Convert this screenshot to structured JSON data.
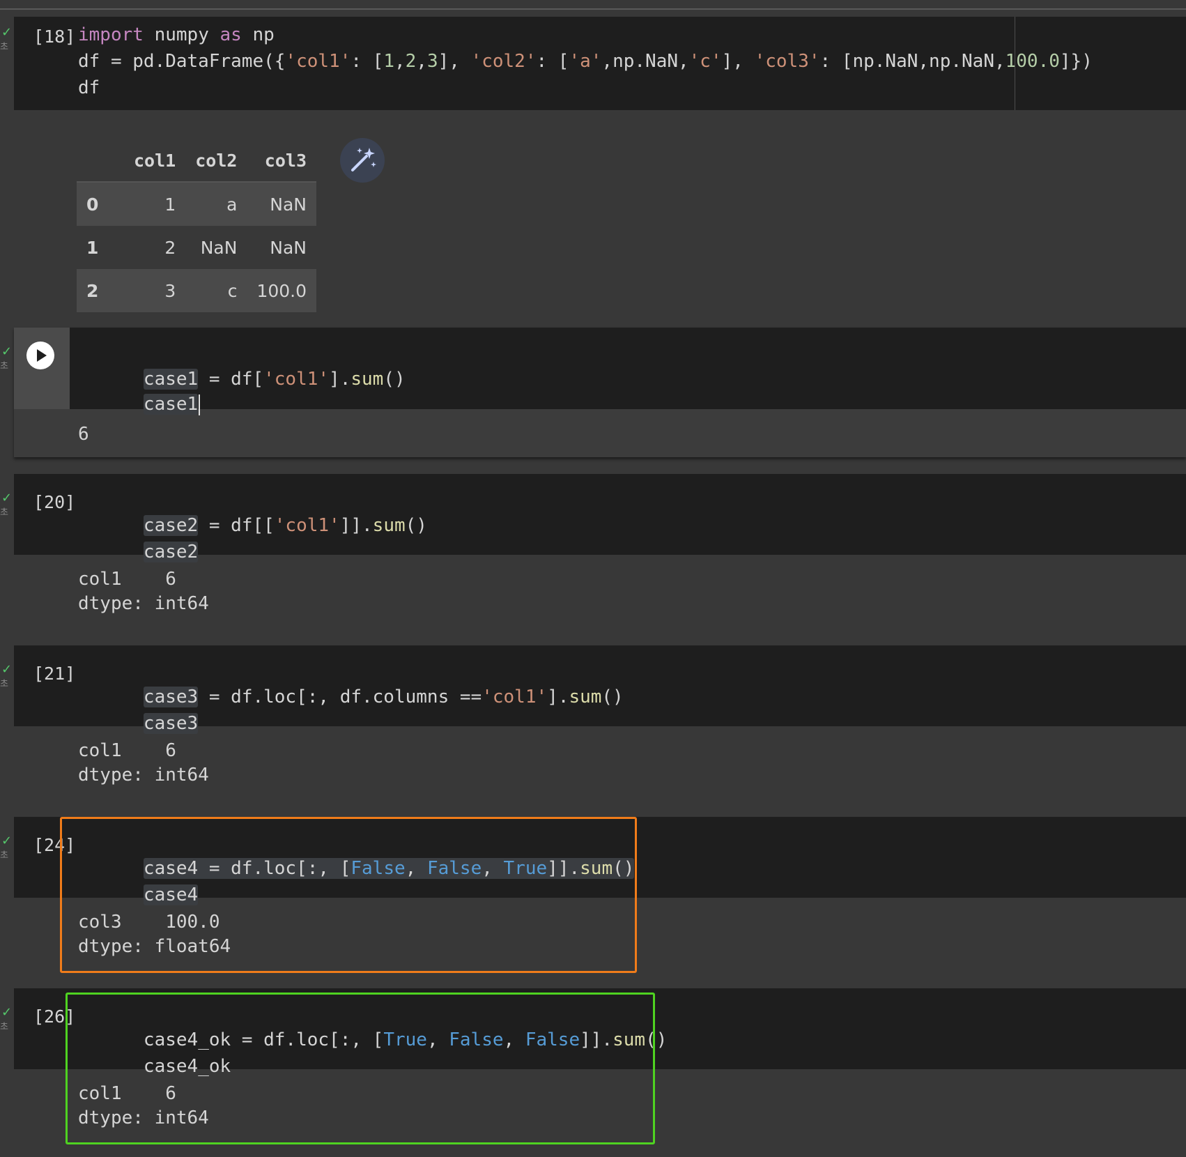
{
  "cells": [
    {
      "id": "cell-18",
      "exec_count": "[18]",
      "code": [
        [
          "kw:import",
          " numpy ",
          "kw:as",
          " np"
        ],
        [
          "df = pd.DataFrame({",
          "str:'col1'",
          ": [",
          "num:1",
          ",",
          "num:2",
          ",",
          "num:3",
          "], ",
          "str:'col2'",
          ": [",
          "str:'a'",
          ",np.NaN,",
          "str:'c'",
          "], ",
          "str:'col3'",
          ": [np.NaN,np.NaN,",
          "num:100.0",
          "]})"
        ],
        [
          "df"
        ]
      ],
      "dataframe": {
        "columns": [
          "col1",
          "col2",
          "col3"
        ],
        "rows": [
          {
            "index": "0",
            "values": [
              "1",
              "a",
              "NaN"
            ]
          },
          {
            "index": "1",
            "values": [
              "2",
              "NaN",
              "NaN"
            ]
          },
          {
            "index": "2",
            "values": [
              "3",
              "c",
              "100.0"
            ]
          }
        ]
      }
    },
    {
      "id": "cell-19",
      "exec_count": "",
      "code_line1": {
        "a": "case1",
        "b": " = df[",
        "c": "'col1'",
        "d": "].",
        "e": "sum",
        "f": "()"
      },
      "code_line2": "case1",
      "output": "6"
    },
    {
      "id": "cell-20",
      "exec_count": "[20]",
      "code_line1": {
        "a": "case2",
        "b": " = df[[",
        "c": "'col1'",
        "d": "]].",
        "e": "sum",
        "f": "()"
      },
      "code_line2": "case2",
      "output_line1": "col1    6",
      "output_line2": "dtype: int64"
    },
    {
      "id": "cell-21",
      "exec_count": "[21]",
      "code_line1": {
        "a": "case3",
        "b": " = df.loc[:, df.columns ==",
        "c": "'col1'",
        "d": "].",
        "e": "sum",
        "f": "()"
      },
      "code_line2": "case3",
      "output_line1": "col1    6",
      "output_line2": "dtype: int64"
    },
    {
      "id": "cell-24",
      "exec_count": "[24]",
      "code_line1": {
        "a": "case4",
        "b": " = df.loc[:, [",
        "c1": "False",
        "s1": ", ",
        "c2": "False",
        "s2": ", ",
        "c3": "True",
        "d": "]].",
        "e": "sum",
        "f": "()"
      },
      "code_line2": "case4",
      "output_line1": "col3    100.0",
      "output_line2": "dtype: float64"
    },
    {
      "id": "cell-26",
      "exec_count": "[26]",
      "code_line1": {
        "a": "case4_ok",
        "b": " = df.loc[:, [",
        "c1": "True",
        "s1": ", ",
        "c2": "False",
        "s2": ", ",
        "c3": "False",
        "d": "]].",
        "e": "sum",
        "f": "()"
      },
      "code_line2": "case4_ok",
      "output_line1": "col1    6",
      "output_line2": "dtype: int64"
    }
  ],
  "gutter": {
    "tick": "✓",
    "mini": "초"
  },
  "colors": {
    "highlight_orange": "#f07c1a",
    "highlight_green": "#4fd321",
    "keyword": "#c586c0",
    "string": "#ce9178",
    "number": "#b5cea8",
    "function": "#dcdcaa",
    "boolean": "#569cd6"
  }
}
